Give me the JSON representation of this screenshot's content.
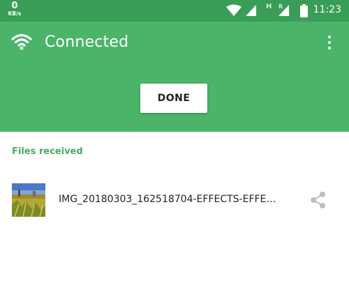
{
  "status_bar": {
    "net_speed": "0",
    "net_speed_unit": "KB/s",
    "network_letter_1": "H",
    "network_letter_2": "R",
    "time": "11:23"
  },
  "app_bar": {
    "title": "Connected",
    "done_label": "DONE",
    "accent_color": "#4bb469"
  },
  "files": {
    "header": "Files received",
    "items": [
      {
        "name": "IMG_20180303_162518704-EFFECTS-EFFE…",
        "icon": "share-icon"
      }
    ]
  }
}
